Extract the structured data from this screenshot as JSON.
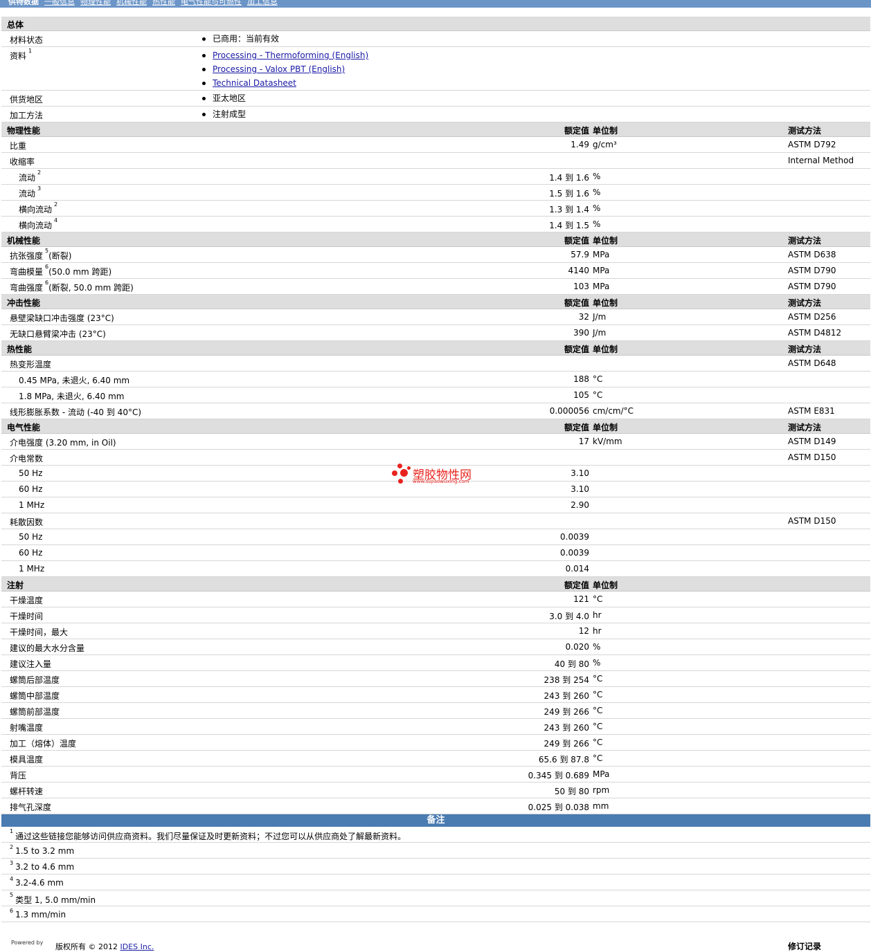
{
  "nav": [
    "供特数据",
    "一般信息",
    "物理性能",
    "机械性能",
    "热性能",
    "电气性能与可燃性",
    "加工信息"
  ],
  "headers": {
    "value": "额定值",
    "unit": "单位制",
    "test": "测试方法"
  },
  "general": {
    "title": "总体",
    "status_label": "材料状态",
    "status_value": "已商用：当前有效",
    "docs_label": "资料",
    "docs_sup": "1",
    "docs": [
      "Processing - Thermoforming (English)",
      "Processing - Valox PBT (English)",
      "Technical Datasheet"
    ],
    "region_label": "供货地区",
    "region_value": "亚太地区",
    "method_label": "加工方法",
    "method_value": "注射成型"
  },
  "sections": [
    {
      "title": "物理性能",
      "header": true,
      "rows": [
        {
          "name": "比重",
          "value": "1.49",
          "unit": "g/cm³",
          "test": "ASTM D792"
        },
        {
          "name": "收缩率",
          "value": "",
          "unit": "",
          "test": "Internal Method"
        },
        {
          "name": "流动",
          "sup": "2",
          "indent": true,
          "value": "1.4 到  1.6",
          "unit": "%",
          "test": ""
        },
        {
          "name": "流动",
          "sup": "3",
          "indent": true,
          "value": "1.5 到  1.6",
          "unit": "%",
          "test": ""
        },
        {
          "name": "横向流动",
          "sup": "2",
          "indent": true,
          "value": "1.3 到  1.4",
          "unit": "%",
          "test": ""
        },
        {
          "name": "横向流动",
          "sup": "4",
          "indent": true,
          "value": "1.4 到  1.5",
          "unit": "%",
          "test": ""
        }
      ]
    },
    {
      "title": "机械性能",
      "header": true,
      "rows": [
        {
          "name": "抗张强度",
          "sup": "5",
          "suffix": "(断裂)",
          "value": "57.9",
          "unit": "MPa",
          "test": "ASTM D638"
        },
        {
          "name": "弯曲模量",
          "sup": "6",
          "suffix": "(50.0 mm 跨距)",
          "value": "4140",
          "unit": "MPa",
          "test": "ASTM D790"
        },
        {
          "name": "弯曲强度",
          "sup": "6",
          "suffix": "(断裂, 50.0 mm 跨距)",
          "value": "103",
          "unit": "MPa",
          "test": "ASTM D790"
        }
      ]
    },
    {
      "title": "冲击性能",
      "header": true,
      "rows": [
        {
          "name": "悬壁梁缺口冲击强度  (23°C)",
          "value": "32",
          "unit": "J/m",
          "test": "ASTM D256"
        },
        {
          "name": "无缺口悬臂梁冲击  (23°C)",
          "value": "390",
          "unit": "J/m",
          "test": "ASTM D4812"
        }
      ]
    },
    {
      "title": "热性能",
      "header": true,
      "rows": [
        {
          "name": "热变形温度",
          "value": "",
          "unit": "",
          "test": "ASTM D648"
        },
        {
          "name": "0.45 MPa, 未退火, 6.40 mm",
          "indent": true,
          "value": "188",
          "unit": "°C",
          "test": ""
        },
        {
          "name": "1.8 MPa, 未退火, 6.40 mm",
          "indent": true,
          "value": "105",
          "unit": "°C",
          "test": ""
        },
        {
          "name": "线形膨胀系数  - 流动  (-40 到  40°C)",
          "value": "0.000056",
          "unit": "cm/cm/°C",
          "test": "ASTM E831"
        }
      ]
    },
    {
      "title": "电气性能",
      "header": true,
      "rows": [
        {
          "name": "介电强度  (3.20 mm, in Oil)",
          "value": "17",
          "unit": "kV/mm",
          "test": "ASTM D149"
        },
        {
          "name": "介电常数",
          "value": "",
          "unit": "",
          "test": "ASTM D150"
        },
        {
          "name": "50 Hz",
          "indent": true,
          "value": "3.10",
          "unit": "",
          "test": ""
        },
        {
          "name": "60 Hz",
          "indent": true,
          "value": "3.10",
          "unit": "",
          "test": ""
        },
        {
          "name": "1 MHz",
          "indent": true,
          "value": "2.90",
          "unit": "",
          "test": ""
        },
        {
          "name": "耗散因数",
          "value": "",
          "unit": "",
          "test": "ASTM D150"
        },
        {
          "name": "50 Hz",
          "indent": true,
          "value": "0.0039",
          "unit": "",
          "test": ""
        },
        {
          "name": "60 Hz",
          "indent": true,
          "value": "0.0039",
          "unit": "",
          "test": ""
        },
        {
          "name": "1 MHz",
          "indent": true,
          "value": "0.014",
          "unit": "",
          "test": ""
        }
      ]
    },
    {
      "title": "注射",
      "header": true,
      "notest": true,
      "rows": [
        {
          "name": "干燥温度",
          "value": "121",
          "unit": "°C",
          "test": ""
        },
        {
          "name": "干燥时间",
          "value": "3.0 到  4.0",
          "unit": "hr",
          "test": ""
        },
        {
          "name": "干燥时间，最大",
          "value": "12",
          "unit": "hr",
          "test": ""
        },
        {
          "name": "建议的最大水分含量",
          "value": "0.020",
          "unit": "%",
          "test": ""
        },
        {
          "name": "建议注入量",
          "value": "40 到  80",
          "unit": "%",
          "test": ""
        },
        {
          "name": "螺筒后部温度",
          "value": "238 到  254",
          "unit": "°C",
          "test": ""
        },
        {
          "name": "螺筒中部温度",
          "value": "243 到  260",
          "unit": "°C",
          "test": ""
        },
        {
          "name": "螺筒前部温度",
          "value": "249 到  266",
          "unit": "°C",
          "test": ""
        },
        {
          "name": "射嘴温度",
          "value": "243 到  260",
          "unit": "°C",
          "test": ""
        },
        {
          "name": "加工（熔体）温度",
          "value": "249 到  266",
          "unit": "°C",
          "test": ""
        },
        {
          "name": "模具温度",
          "value": "65.6 到  87.8",
          "unit": "°C",
          "test": ""
        },
        {
          "name": "背压",
          "value": "0.345 到  0.689",
          "unit": "MPa",
          "test": ""
        },
        {
          "name": "螺杆转速",
          "value": "50 到  80",
          "unit": "rpm",
          "test": ""
        },
        {
          "name": "排气孔深度",
          "value": "0.025 到  0.038",
          "unit": "mm",
          "test": ""
        }
      ]
    }
  ],
  "notes": {
    "title": "备注",
    "items": [
      {
        "sup": "1",
        "text": "通过这些链接您能够访问供应商资料。我们尽量保证及时更新资料；不过您可以从供应商处了解最新资料。"
      },
      {
        "sup": "2",
        "text": "1.5 to 3.2 mm"
      },
      {
        "sup": "3",
        "text": "3.2 to 4.6 mm"
      },
      {
        "sup": "4",
        "text": "3.2-4.6 mm"
      },
      {
        "sup": "5",
        "text": "类型  1, 5.0 mm/min"
      },
      {
        "sup": "6",
        "text": "1.3 mm/min"
      }
    ]
  },
  "footer": {
    "powered": "Powered by",
    "copyright": "版权所有  © 2012",
    "company": "IDES Inc.",
    "revision": "修订记录"
  },
  "watermark": {
    "name": "塑胶物性网",
    "url": "www.sujiaowuxing.com"
  },
  "colors": {
    "topbar": "#6b94c7",
    "section": "#dedede",
    "notes": "#4a7bb1",
    "link": "#1a1aa6",
    "watermark": "#e8231e"
  }
}
